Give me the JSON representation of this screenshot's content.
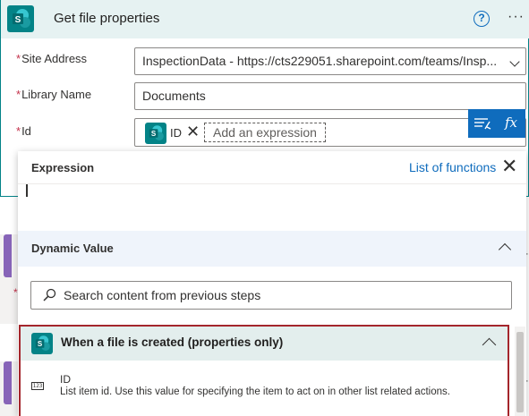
{
  "action": {
    "title": "Get file properties",
    "help_icon": "help-circle-icon",
    "help_glyph": "?",
    "more_icon": "ellipsis-icon",
    "more_glyph": "···",
    "accent_color": "#038387"
  },
  "fields": {
    "required_mark": "*",
    "site_address": {
      "label": "Site Address",
      "value": "InspectionData - https://cts229051.sharepoint.com/teams/Insp..."
    },
    "library_name": {
      "label": "Library Name",
      "value": "Documents"
    },
    "id": {
      "label": "Id",
      "token_label": "ID",
      "token_remove_glyph": "✕",
      "placeholder": "Add an expression"
    }
  },
  "buttons": {
    "dynamic_content_icon": "dynamic-content-icon",
    "expression_label": "fx"
  },
  "flyout": {
    "title": "Expression",
    "list_functions": "List of functions",
    "close_glyph": "✕",
    "dynamic_value_title": "Dynamic Value",
    "search_placeholder": "Search content from previous steps",
    "trigger": {
      "title": "When a file is created (properties only)",
      "item_icon_text": "123",
      "item_name": "ID",
      "item_description": "List item id. Use this value for specifying the item to act on in other list related actions."
    }
  },
  "colors": {
    "brand_blue": "#0f6cbd",
    "highlight_border": "#a4262c"
  }
}
